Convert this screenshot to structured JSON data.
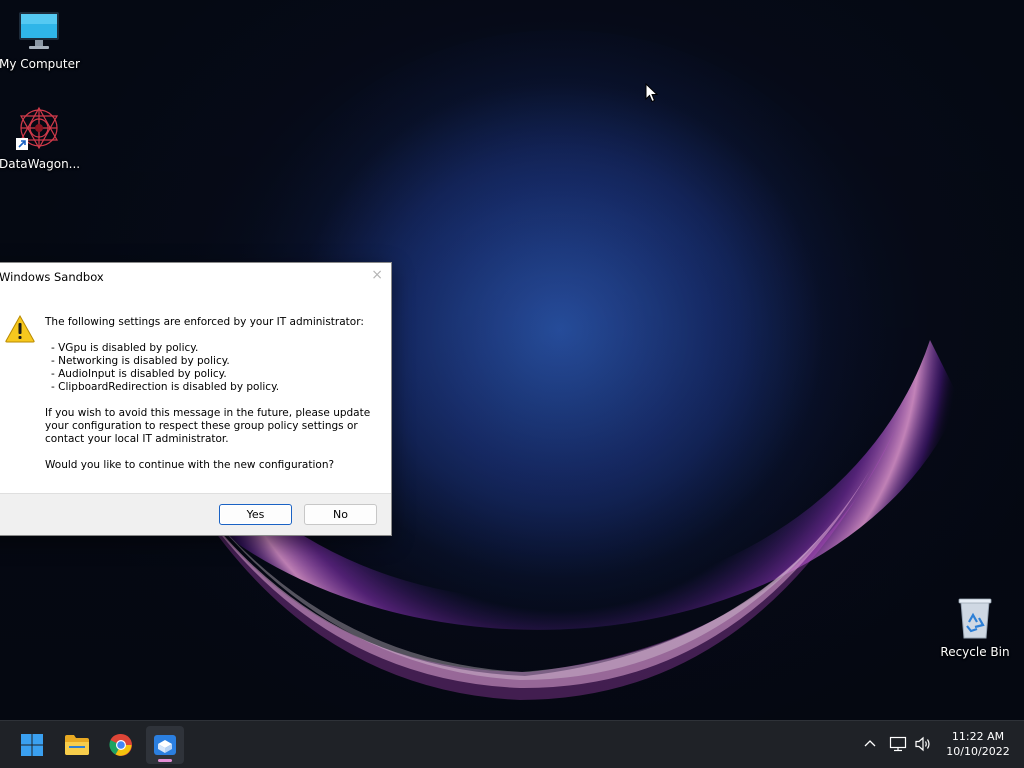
{
  "desktop": {
    "icons": [
      {
        "label": "My Computer",
        "icon": "monitor-icon"
      },
      {
        "label": "DataWagon...",
        "icon": "datawagon-icon",
        "shortcut": true
      },
      {
        "label": "Recycle Bin",
        "icon": "recycle-bin-icon"
      }
    ]
  },
  "dialog": {
    "title": "Windows Sandbox",
    "close_label": "×",
    "icon": "warning-icon",
    "heading": "The following settings are enforced by your IT administrator:",
    "bullets": [
      "- VGpu is disabled by policy.",
      "- Networking is disabled by policy.",
      "- AudioInput is disabled by policy.",
      "- ClipboardRedirection is disabled by policy."
    ],
    "paragraph_lines": [
      "If you wish to avoid this message in the future, please update",
      "your configuration to respect these group policy settings or",
      "contact your local IT administrator."
    ],
    "question": "Would you like to continue with the new configuration?",
    "yes_label": "Yes",
    "no_label": "No"
  },
  "taskbar": {
    "apps": [
      {
        "name": "Start",
        "icon": "windows-logo-icon"
      },
      {
        "name": "File Explorer",
        "icon": "folder-icon"
      },
      {
        "name": "Google Chrome",
        "icon": "chrome-icon"
      },
      {
        "name": "Windows Sandbox",
        "icon": "sandbox-icon",
        "active": true
      }
    ],
    "tray": {
      "icons": [
        "chevron-up-icon",
        "network-icon",
        "volume-icon"
      ]
    },
    "clock": {
      "time": "11:22 AM",
      "date": "10/10/2022"
    }
  },
  "colors": {
    "accent": "#1a62c4",
    "taskbar": "#1f2227",
    "desktop_bg": "#050913"
  }
}
